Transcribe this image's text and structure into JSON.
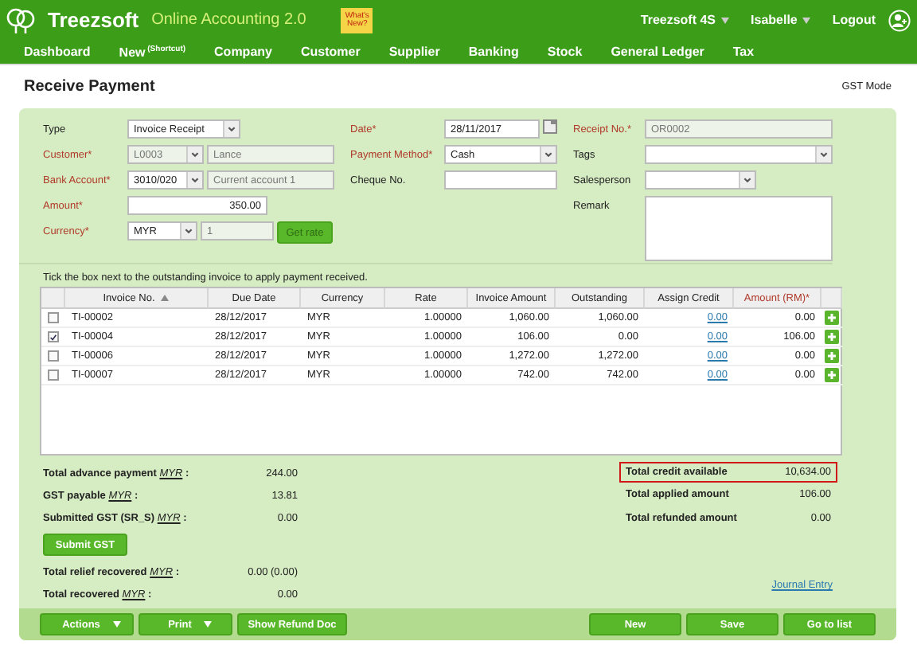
{
  "header": {
    "brand": "Treezsoft",
    "product": "Online Accounting 2.0",
    "note": "What's New?",
    "menus": [
      {
        "label": "Treezsoft 4S",
        "dropdown": true
      },
      {
        "label": "Isabelle",
        "dropdown": true
      },
      {
        "label": "Logout",
        "dropdown": false
      }
    ]
  },
  "nav": [
    {
      "label": "Dashboard"
    },
    {
      "label": "New",
      "sup": "(Shortcut)"
    },
    {
      "label": "Company"
    },
    {
      "label": "Customer"
    },
    {
      "label": "Supplier"
    },
    {
      "label": "Banking"
    },
    {
      "label": "Stock"
    },
    {
      "label": "General Ledger"
    },
    {
      "label": "Tax"
    }
  ],
  "page": {
    "title": "Receive Payment",
    "mode": "GST Mode"
  },
  "form": {
    "columns": [
      [
        {
          "kind": "select",
          "label": "Type",
          "required": false,
          "value": "Invoice Receipt"
        },
        {
          "kind": "combo",
          "label": "Customer*",
          "required": true,
          "value": "L0003",
          "value2": "Lance",
          "disabled": true
        },
        {
          "kind": "combo",
          "label": "Bank Account*",
          "required": true,
          "value": "3010/020",
          "value2": "Current account 1",
          "disabled": false
        },
        {
          "kind": "amount",
          "label": "Amount*",
          "required": true,
          "value": "350.00"
        },
        {
          "kind": "currency",
          "label": "Currency*",
          "required": true,
          "value": "MYR",
          "value2": "1",
          "button": "Get rate"
        }
      ],
      [
        {
          "kind": "date",
          "label": "Date*",
          "required": true,
          "value": "28/11/2017"
        },
        {
          "kind": "select",
          "label": "Payment Method*",
          "required": true,
          "value": "Cash"
        },
        {
          "kind": "text",
          "label": "Cheque No.",
          "required": false
        }
      ],
      [
        {
          "kind": "text",
          "label": "Receipt No.*",
          "required": true,
          "value": "OR0002",
          "disabled": true
        },
        {
          "kind": "select",
          "label": "Tags",
          "required": false
        },
        {
          "kind": "shortselect",
          "label": "Salesperson",
          "required": false
        },
        {
          "kind": "area",
          "label": "Remark",
          "required": false
        }
      ]
    ]
  },
  "instruction": "Tick the box next to the outstanding invoice to apply payment received.",
  "table": {
    "columns": [
      {
        "label": "Invoice No.",
        "sorted": true,
        "required": false
      },
      {
        "label": "Due Date",
        "sorted": false,
        "required": false
      },
      {
        "label": "Currency",
        "sorted": false,
        "required": false
      },
      {
        "label": "Rate",
        "sorted": false,
        "required": false
      },
      {
        "label": "Invoice Amount",
        "sorted": false,
        "required": false
      },
      {
        "label": "Outstanding",
        "sorted": false,
        "required": false
      },
      {
        "label": "Assign Credit",
        "sorted": false,
        "required": false
      },
      {
        "label": "Amount (RM)*",
        "sorted": false,
        "required": true
      }
    ],
    "rows": [
      {
        "checked": false,
        "cells": [
          "TI-00002",
          "28/12/2017",
          "MYR",
          "1.00000",
          "1,060.00",
          "1,060.00",
          "0.00",
          "0.00"
        ]
      },
      {
        "checked": true,
        "cells": [
          "TI-00004",
          "28/12/2017",
          "MYR",
          "1.00000",
          "106.00",
          "0.00",
          "0.00",
          "106.00"
        ]
      },
      {
        "checked": false,
        "cells": [
          "TI-00006",
          "28/12/2017",
          "MYR",
          "1.00000",
          "1,272.00",
          "1,272.00",
          "0.00",
          "0.00"
        ]
      },
      {
        "checked": false,
        "cells": [
          "TI-00007",
          "28/12/2017",
          "MYR",
          "1.00000",
          "742.00",
          "742.00",
          "0.00",
          "0.00"
        ]
      }
    ]
  },
  "summary_left": [
    {
      "label": "Total advance payment",
      "currency": "MYR",
      "separator": ":",
      "value": "244.00"
    },
    {
      "label": "GST payable",
      "currency": "MYR",
      "separator": ":",
      "value": "13.81"
    },
    {
      "label": "Submitted GST (SR_S)",
      "currency": "MYR",
      "separator": ":",
      "value": "0.00"
    },
    {
      "kind": "button",
      "label": "Submit GST"
    },
    {
      "label": "Total relief recovered",
      "currency": "MYR",
      "separator": ":",
      "value": "0.00 (0.00)"
    },
    {
      "label": "Total recovered",
      "currency": "MYR",
      "separator": ":",
      "value": "0.00"
    }
  ],
  "summary_right": [
    {
      "label": "Total credit available",
      "value": "10,634.00",
      "highlighted": true
    },
    {
      "label": "Total applied amount",
      "value": "106.00",
      "highlighted": false
    },
    {
      "label": "Total refunded amount",
      "value": "0.00",
      "highlighted": false
    }
  ],
  "journal_link": "Journal Entry",
  "footer": {
    "left": [
      {
        "label": "Actions",
        "dropdown": true
      },
      {
        "label": "Print",
        "dropdown": true
      },
      {
        "label": "Show Refund Doc",
        "dropdown": false
      }
    ],
    "right": [
      {
        "label": "New"
      },
      {
        "label": "Save"
      },
      {
        "label": "Go to list"
      }
    ]
  }
}
